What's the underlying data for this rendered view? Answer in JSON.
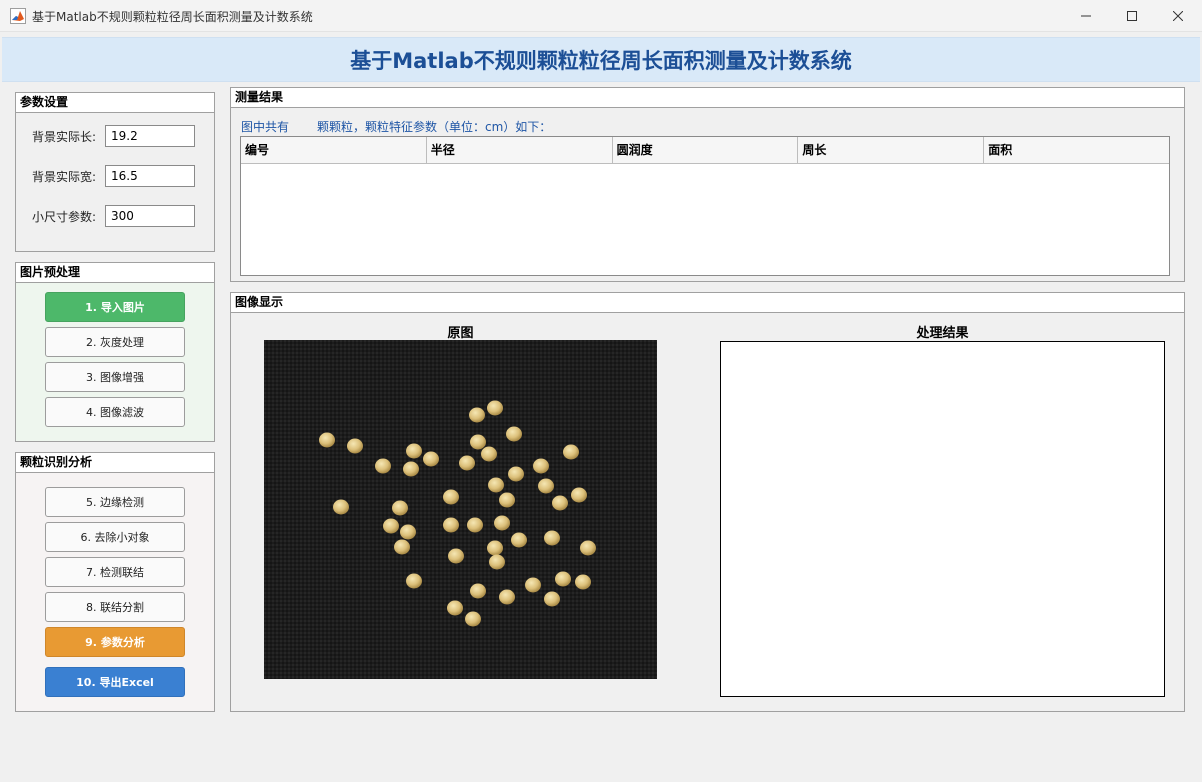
{
  "window": {
    "title": "基于Matlab不规则颗粒粒径周长面积测量及计数系统",
    "icons": [
      "matlab-icon",
      "minimize-icon",
      "maximize-icon",
      "close-icon"
    ]
  },
  "banner": {
    "title": "基于Matlab不规则颗粒粒径周长面积测量及计数系统",
    "color": "#1c4f96"
  },
  "params": {
    "title": "参数设置",
    "fields": [
      {
        "label": "背景实际长:",
        "value": "19.2"
      },
      {
        "label": "背景实际宽:",
        "value": "16.5"
      },
      {
        "label": "小尺寸参数:",
        "value": "300"
      }
    ]
  },
  "preprocess": {
    "title": "图片预处理",
    "buttons": [
      "1. 导入图片",
      "2. 灰度处理",
      "3. 图像增强",
      "4. 图像滤波"
    ]
  },
  "analysis": {
    "title": "颗粒识别分析",
    "buttons": [
      "5. 边缘检测",
      "6. 去除小对象",
      "7. 检测联结",
      "8. 联结分割",
      "9. 参数分析",
      "10. 导出Excel"
    ]
  },
  "results": {
    "title": "测量结果",
    "count_prefix": "图中共有",
    "count_value": "",
    "count_suffix": "颗颗粒，颗粒特征参数（单位：cm）如下：",
    "columns": [
      "编号",
      "半径",
      "圆润度",
      "周长",
      "面积"
    ],
    "rows": []
  },
  "display": {
    "title": "图像显示",
    "original_label": "原图",
    "result_label": "处理结果"
  },
  "colors": {
    "accent_green": "#4db86a",
    "accent_orange": "#e89a33",
    "accent_blue": "#3a80d2",
    "banner_bg": "#d9e9f8"
  }
}
